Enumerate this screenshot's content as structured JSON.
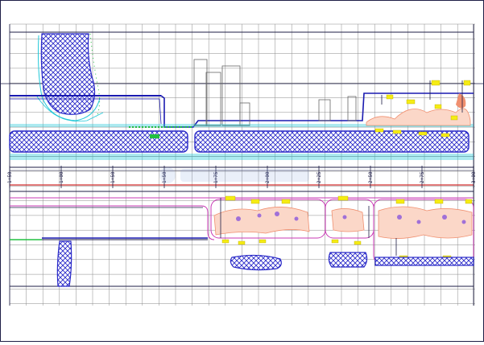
{
  "drawing": {
    "station_labels": [
      "1+50",
      "1+00",
      "1+50",
      "1+50",
      "1+75",
      "2+00",
      "2+25",
      "2+50",
      "2+75",
      "3+00"
    ],
    "colors": {
      "grid": "#8a8a8a",
      "road_outline": "#1a1ab0",
      "hatch": "#2a2ac8",
      "dark_line": "#1e1e46",
      "cyan": "#21c8d8",
      "magenta": "#c838b4",
      "red": "#d02a2a",
      "green": "#22c040",
      "yellow": "#f5ec14",
      "orange": "#f09070",
      "violet": "#a070d8",
      "gray": "#666666"
    }
  }
}
